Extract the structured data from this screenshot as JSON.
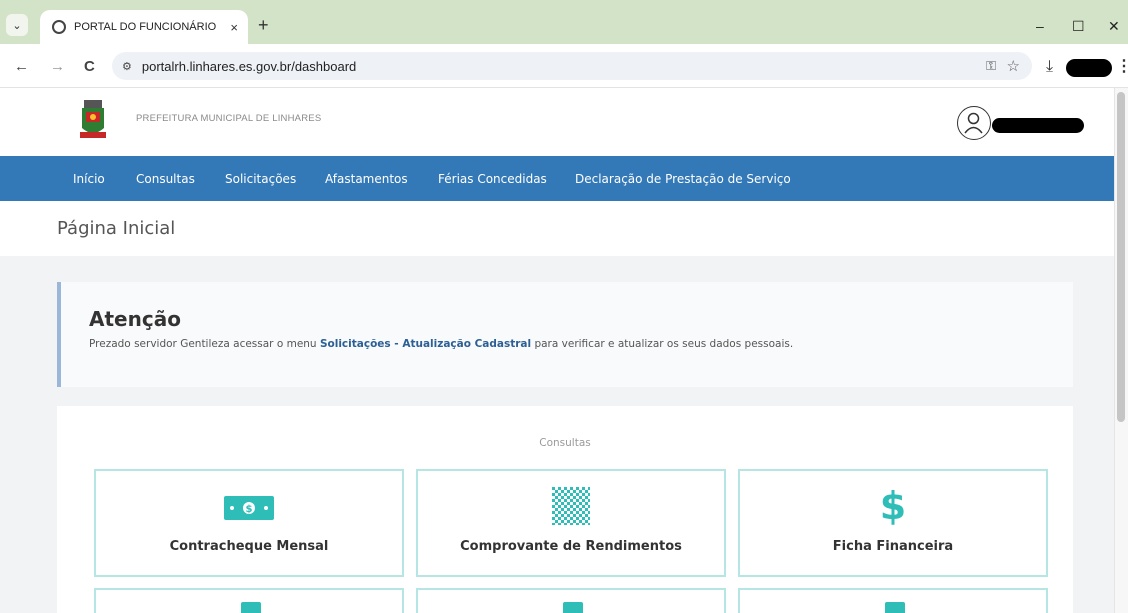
{
  "browser": {
    "tab_title": "PORTAL DO FUNCIONÁRIO",
    "tab_close": "×",
    "new_tab": "+",
    "url": "portalrh.linhares.es.gov.br/dashboard",
    "window_controls": {
      "minimize": "–",
      "maximize": "☐",
      "close": "✕"
    },
    "nav": {
      "back": "←",
      "forward": "→",
      "reload": "C"
    }
  },
  "header": {
    "org_name": "PREFEITURA MUNICIPAL DE LINHARES"
  },
  "menu": {
    "items": [
      "Início",
      "Consultas",
      "Solicitações",
      "Afastamentos",
      "Férias Concedidas",
      "Declaração de Prestação de Serviço"
    ]
  },
  "page": {
    "title": "Página Inicial"
  },
  "alert": {
    "title": "Atenção",
    "text_before": "Prezado servidor Gentileza acessar o menu ",
    "text_link": "Solicitações - Atualização Cadastral",
    "text_after": " para verificar e atualizar os seus dados pessoais."
  },
  "consultas": {
    "section_label": "Consultas",
    "cards": [
      {
        "label": "Contracheque Mensal",
        "icon": "money-bill-icon"
      },
      {
        "label": "Comprovante de Rendimentos",
        "icon": "checker-grid-icon"
      },
      {
        "label": "Ficha Financeira",
        "icon": "dollar-icon"
      }
    ]
  },
  "colors": {
    "menu_bg": "#3479b7",
    "accent_teal": "#2fbdb7",
    "tab_strip": "#d3e3c8"
  }
}
